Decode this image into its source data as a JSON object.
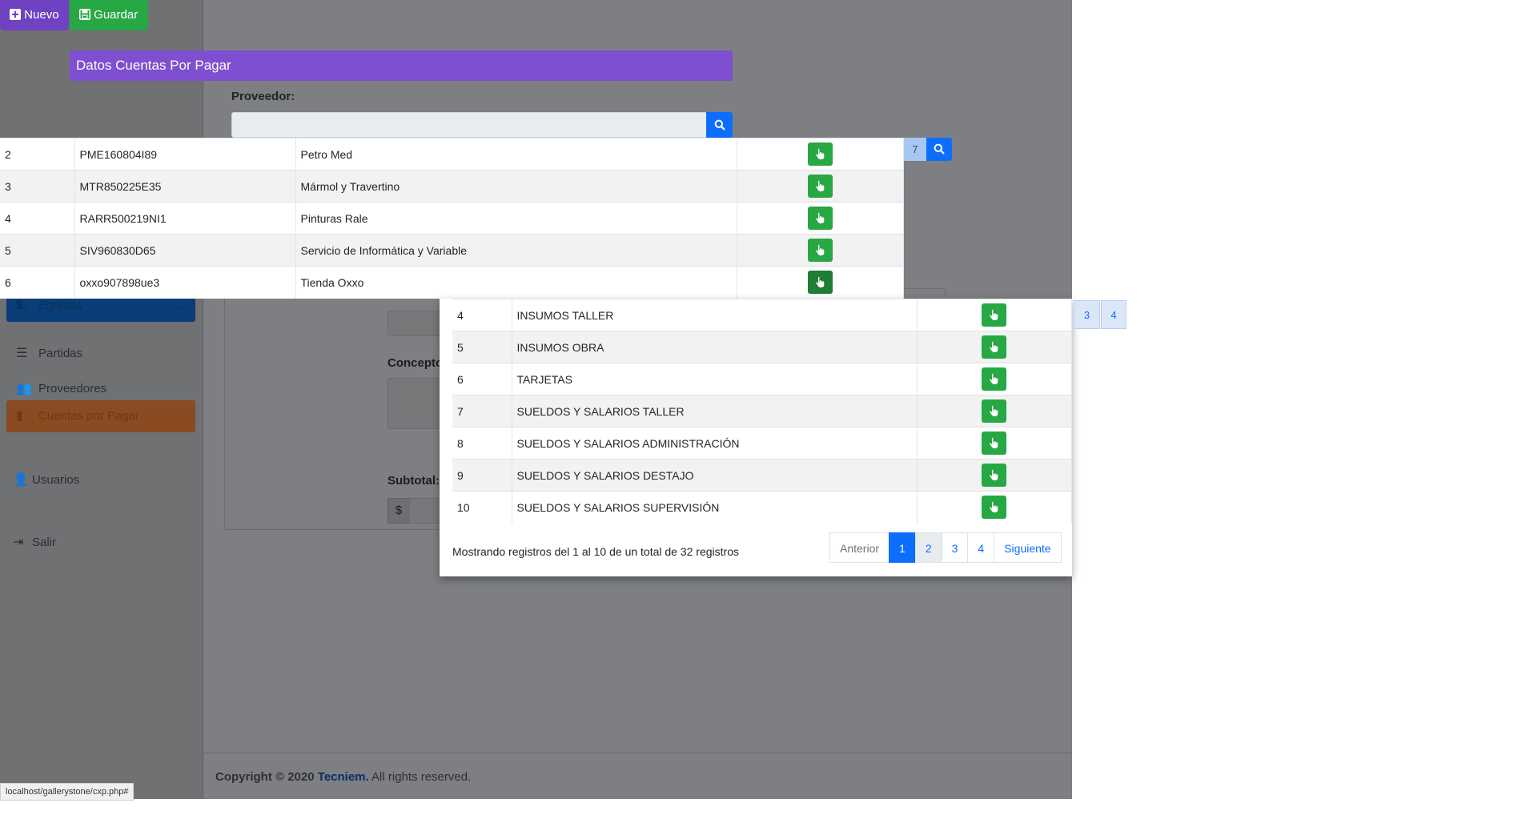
{
  "toolbar": {
    "nuevo_label": "Nuevo",
    "guardar_label": "Guardar"
  },
  "panel": {
    "title": "Datos Cuentas Por Pagar",
    "proveedor_label": "Proveedor:"
  },
  "proveedores_rows": [
    {
      "id": "2",
      "rfc": "PME160804I89",
      "nombre": "Petro Med"
    },
    {
      "id": "3",
      "rfc": "MTR850225E35",
      "nombre": "Mármol y Travertino"
    },
    {
      "id": "4",
      "rfc": "RARR500219NI1",
      "nombre": "Pinturas Rale"
    },
    {
      "id": "5",
      "rfc": "SIV960830D65",
      "nombre": "Servicio de Informática y Variable"
    },
    {
      "id": "6",
      "rfc": "oxxo907898ue3",
      "nombre": "Tienda Oxxo"
    }
  ],
  "fragments": {
    "page_7": "7",
    "page_3": "3",
    "page_4": "4"
  },
  "sidebar": {
    "items": [
      {
        "label": "Egresos"
      },
      {
        "label": "Partidas"
      },
      {
        "label": "Proveedores"
      },
      {
        "label": "Cuentas por Pagar"
      },
      {
        "label": "Usuarios"
      },
      {
        "label": "Salir"
      }
    ]
  },
  "background_form": {
    "concepto_label": "Concepto",
    "subtotal_label": "Subtotal:",
    "currency_symbol": "$"
  },
  "partidas_modal": {
    "rows": [
      {
        "id": "4",
        "nombre": "INSUMOS TALLER"
      },
      {
        "id": "5",
        "nombre": "INSUMOS OBRA"
      },
      {
        "id": "6",
        "nombre": "TARJETAS"
      },
      {
        "id": "7",
        "nombre": "SUELDOS Y SALARIOS TALLER"
      },
      {
        "id": "8",
        "nombre": "SUELDOS Y SALARIOS ADMINISTRACIÓN"
      },
      {
        "id": "9",
        "nombre": "SUELDOS Y SALARIOS DESTAJO"
      },
      {
        "id": "10",
        "nombre": "SUELDOS Y SALARIOS SUPERVISIÓN"
      }
    ],
    "records_info": "Mostrando registros del 1 al 10 de un total de 32 registros",
    "pagination": {
      "prev": "Anterior",
      "pages": [
        "1",
        "2",
        "3",
        "4"
      ],
      "next": "Siguiente"
    }
  },
  "footer": {
    "prefix": "Copyright © 2020",
    "brand": "Tecniem.",
    "suffix": "All rights reserved."
  },
  "status_bar": "localhost/gallerystone/cxp.php#",
  "colors": {
    "purple": "#6f42c1",
    "green": "#28a745",
    "blue": "#0d6efd"
  }
}
